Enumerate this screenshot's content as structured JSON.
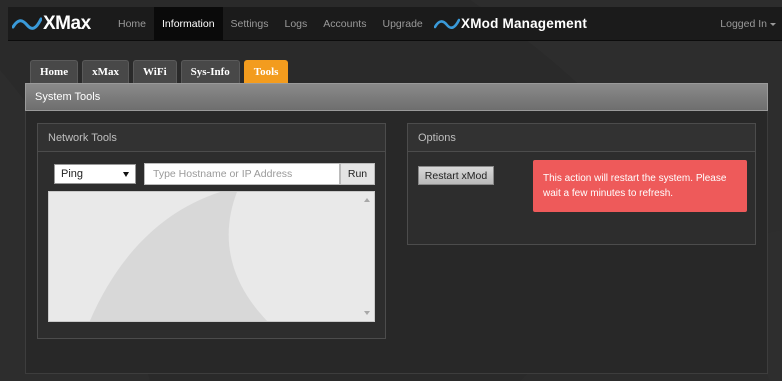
{
  "navbar": {
    "brand": "XMax",
    "items": [
      {
        "label": "Home",
        "active": false
      },
      {
        "label": "Information",
        "active": true
      },
      {
        "label": "Settings",
        "active": false
      },
      {
        "label": "Logs",
        "active": false
      },
      {
        "label": "Accounts",
        "active": false
      },
      {
        "label": "Upgrade",
        "active": false
      }
    ],
    "mod_title": "XMod Management",
    "logged_in": "Logged In"
  },
  "tabs": [
    {
      "label": "Home",
      "active": false
    },
    {
      "label": "xMax",
      "active": false
    },
    {
      "label": "WiFi",
      "active": false
    },
    {
      "label": "Sys-Info",
      "active": false
    },
    {
      "label": "Tools",
      "active": true
    }
  ],
  "system_tools": {
    "title": "System Tools"
  },
  "network_tools": {
    "title": "Network Tools",
    "tool_select": "Ping",
    "host_placeholder": "Type Hostname or IP Address",
    "host_value": "",
    "run_label": "Run",
    "output": ""
  },
  "options": {
    "title": "Options",
    "restart_label": "Restart xMod",
    "alert": "This action will restart the system. Please wait a few minutes to refresh."
  },
  "colors": {
    "accent": "#f39c1e",
    "alert": "#ee5a5a",
    "navbar": "#1b1b1b",
    "wave": "#3a9ad9"
  }
}
